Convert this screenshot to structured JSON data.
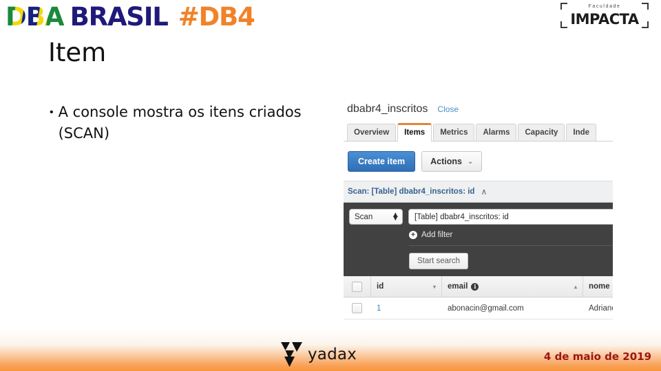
{
  "header": {
    "logo_dba": "DBA",
    "logo_brasil": "BRASIL",
    "logo_hashtag": "#DB4",
    "impacta_small": "Faculdade",
    "impacta_word": "IMPACTA",
    "colors": {
      "brasil_navy": "#1f1a7a",
      "db4_orange": "#f28228",
      "flag_green": "#1a8a3c",
      "flag_yellow": "#f5d60b"
    }
  },
  "slide": {
    "title": "Item",
    "bullet_marker": "•",
    "bullet_text": "A console mostra os itens criados (SCAN)"
  },
  "console": {
    "table_name": "dbabr4_inscritos",
    "close_label": "Close",
    "tabs": [
      {
        "label": "Overview",
        "active": false
      },
      {
        "label": "Items",
        "active": true
      },
      {
        "label": "Metrics",
        "active": false
      },
      {
        "label": "Alarms",
        "active": false
      },
      {
        "label": "Capacity",
        "active": false
      },
      {
        "label": "Inde",
        "active": false
      }
    ],
    "create_item_label": "Create item",
    "actions_label": "Actions",
    "actions_caret": "⌄",
    "scan_bar_label": "Scan: [Table] dbabr4_inscritos: id",
    "scan_bar_chevron": "∧",
    "operation_select_value": "Scan",
    "table_select_value": "[Table] dbabr4_inscritos: id",
    "add_filter_icon": "+",
    "add_filter_label": "Add filter",
    "start_search_label": "Start search",
    "grid": {
      "columns": [
        {
          "label": "id",
          "sort": "▾"
        },
        {
          "label": "email",
          "sort": "▴",
          "info": "i"
        },
        {
          "label": "nome",
          "sort": "▾"
        }
      ],
      "rows": [
        {
          "id": "1",
          "email": "abonacin@gmail.com",
          "nome": "Adriano"
        }
      ]
    }
  },
  "footer": {
    "brand": "yadax",
    "date": "4 de maio de 2019",
    "date_color": "#9c1616"
  }
}
